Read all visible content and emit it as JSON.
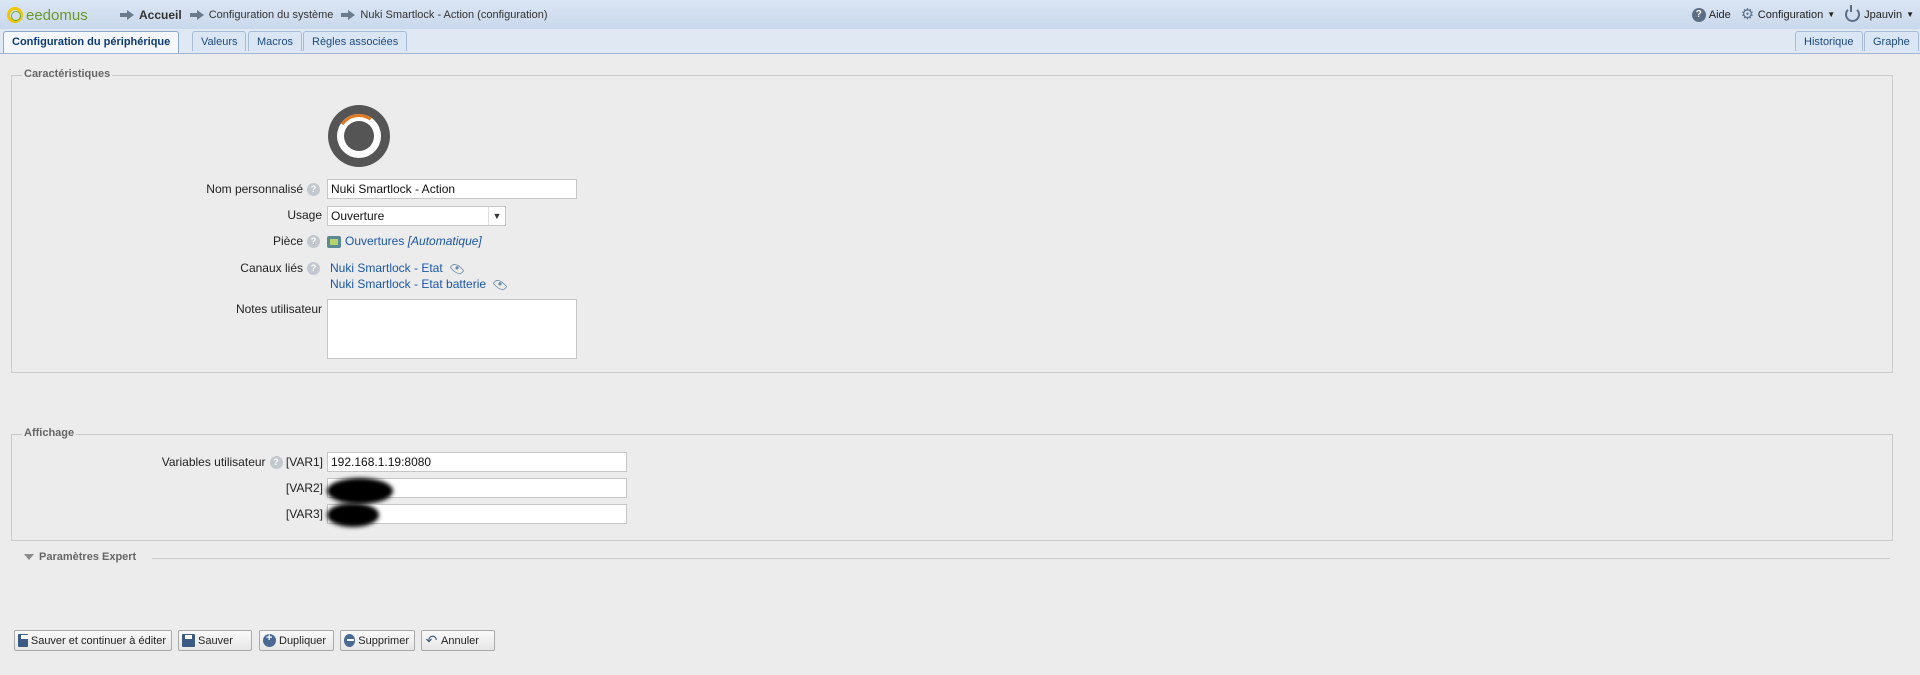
{
  "app": {
    "logo_text": "eedomus"
  },
  "breadcrumb": [
    "Accueil",
    "Configuration du système",
    "Nuki Smartlock - Action (configuration)"
  ],
  "top_right": {
    "help": "Aide",
    "config": "Configuration",
    "user": "Jpauvin"
  },
  "tabs": {
    "left": [
      "Configuration du périphérique",
      "Valeurs",
      "Macros",
      "Règles associées"
    ],
    "right": [
      "Historique",
      "Graphe"
    ],
    "active": "Configuration du périphérique"
  },
  "caracteristiques": {
    "legend": "Caractéristiques",
    "name_label": "Nom personnalisé",
    "name_value": "Nuki Smartlock - Action",
    "usage_label": "Usage",
    "usage_value": "Ouverture",
    "piece_label": "Pièce",
    "piece_value": "Ouvertures",
    "piece_auto": "[Automatique]",
    "canaux_label": "Canaux liés",
    "canaux": [
      "Nuki Smartlock - Etat",
      "Nuki Smartlock - Etat batterie"
    ],
    "notes_label": "Notes utilisateur",
    "notes_value": ""
  },
  "affichage": {
    "legend": "Affichage",
    "vars_label": "Variables utilisateur",
    "var1_tag": "[VAR1]",
    "var1_value": "192.168.1.19:8080",
    "var2_tag": "[VAR2]",
    "var3_tag": "[VAR3]"
  },
  "expert": {
    "label": "Paramètres Expert"
  },
  "buttons": {
    "save_continue": "Sauver et continuer à éditer",
    "save": "Sauver",
    "duplicate": "Dupliquer",
    "delete": "Supprimer",
    "cancel": "Annuler"
  },
  "colors": {
    "header_bg": "#c9d8ec",
    "link": "#1b57a8",
    "page_bg": "#ececec"
  },
  "icons": [
    "arrow-icon",
    "help-icon",
    "gear-icon",
    "power-icon",
    "eye-icon",
    "room-icon",
    "save-icon",
    "duplicate-icon",
    "delete-icon",
    "undo-icon",
    "lock-device-icon"
  ]
}
